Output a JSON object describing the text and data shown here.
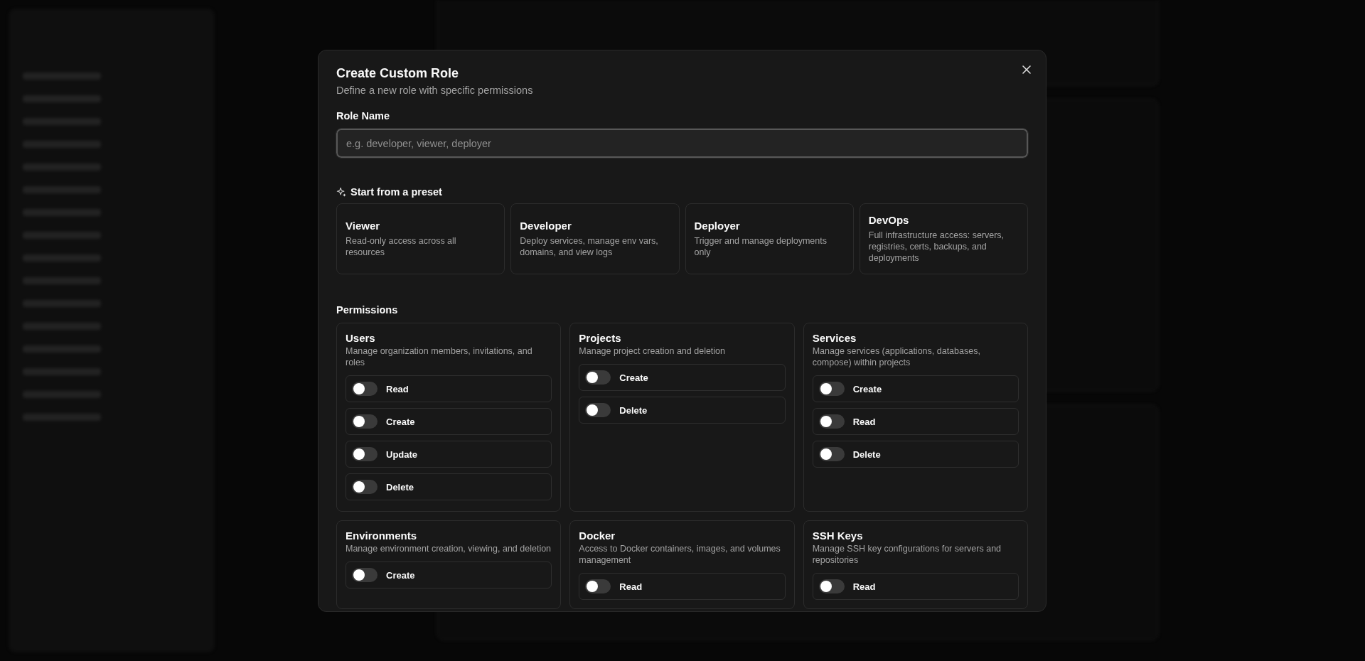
{
  "dialog": {
    "title": "Create Custom Role",
    "subtitle": "Define a new role with specific permissions"
  },
  "role_name": {
    "label": "Role Name",
    "placeholder": "e.g. developer, viewer, deployer"
  },
  "presets": {
    "heading": "Start from a preset",
    "cards": [
      {
        "title": "Viewer",
        "description": "Read-only access across all resources"
      },
      {
        "title": "Developer",
        "description": "Deploy services, manage env vars, domains, and view logs"
      },
      {
        "title": "Deployer",
        "description": "Trigger and manage deployments only"
      },
      {
        "title": "DevOps",
        "description": "Full infrastructure access: servers, registries, certs, backups, and deployments"
      }
    ]
  },
  "permissions": {
    "heading": "Permissions",
    "groups": [
      {
        "title": "Users",
        "description": "Manage organization members, invitations, and roles",
        "toggles": [
          {
            "label": "Read",
            "on": false
          },
          {
            "label": "Create",
            "on": false
          },
          {
            "label": "Update",
            "on": false
          },
          {
            "label": "Delete",
            "on": false
          }
        ]
      },
      {
        "title": "Projects",
        "description": "Manage project creation and deletion",
        "toggles": [
          {
            "label": "Create",
            "on": false
          },
          {
            "label": "Delete",
            "on": false
          }
        ]
      },
      {
        "title": "Services",
        "description": "Manage services (applications, databases, compose) within projects",
        "toggles": [
          {
            "label": "Create",
            "on": false
          },
          {
            "label": "Read",
            "on": false
          },
          {
            "label": "Delete",
            "on": false
          }
        ]
      },
      {
        "title": "Environments",
        "description": "Manage environment creation, viewing, and deletion",
        "toggles": [
          {
            "label": "Create",
            "on": false
          }
        ]
      },
      {
        "title": "Docker",
        "description": "Access to Docker containers, images, and volumes management",
        "toggles": [
          {
            "label": "Read",
            "on": false
          }
        ]
      },
      {
        "title": "SSH Keys",
        "description": "Manage SSH key configurations for servers and repositories",
        "toggles": [
          {
            "label": "Read",
            "on": false
          }
        ]
      }
    ]
  }
}
